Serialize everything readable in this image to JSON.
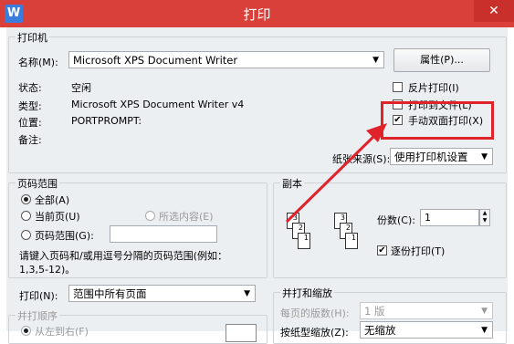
{
  "window": {
    "title": "打印",
    "app_icon": "W",
    "close_label": "✕"
  },
  "printer": {
    "group_label": "打印机",
    "name_label": "名称(M):",
    "name_value": "Microsoft XPS Document Writer",
    "properties_button": "属性(P)...",
    "status_label": "状态:",
    "status_value": "空闲",
    "type_label": "类型:",
    "type_value": "Microsoft XPS Document Writer v4",
    "location_label": "位置:",
    "location_value": "PORTPROMPT:",
    "comment_label": "备注:",
    "reverse_print": "反片打印(I)",
    "print_to_file": "打印到文件(L)",
    "manual_duplex": "手动双面打印(X)",
    "manual_duplex_checked": true,
    "paper_source_label": "纸张来源(S):",
    "paper_source_value": "使用打印机设置"
  },
  "page_range": {
    "group_label": "页码范围",
    "all": "全部(A)",
    "current": "当前页(U)",
    "selection": "所选内容(E)",
    "pages": "页码范围(G):",
    "hint_line1": "请键入页码和/或用逗号分隔的页码范围(例如：",
    "hint_line2": "1,3,5-12)。"
  },
  "copies": {
    "group_label": "副本",
    "count_label": "份数(C):",
    "count_value": "1",
    "collate": "逐份打印(T)",
    "collate_checked": true
  },
  "print_what": {
    "label": "打印(N):",
    "value": "范围中所有页面",
    "order_label": "并打顺序",
    "order_left_to_right": "从左到右(F)"
  },
  "zoom": {
    "group_label": "并打和缩放",
    "pages_per_sheet_label": "每页的版数(H):",
    "pages_per_sheet_value": "1 版",
    "scale_label": "按纸型缩放(Z):",
    "scale_value": "无缩放"
  },
  "colors": {
    "titlebar": "#d9403a",
    "highlight": "#e0232b",
    "dialog_bg": "#eceff2"
  }
}
